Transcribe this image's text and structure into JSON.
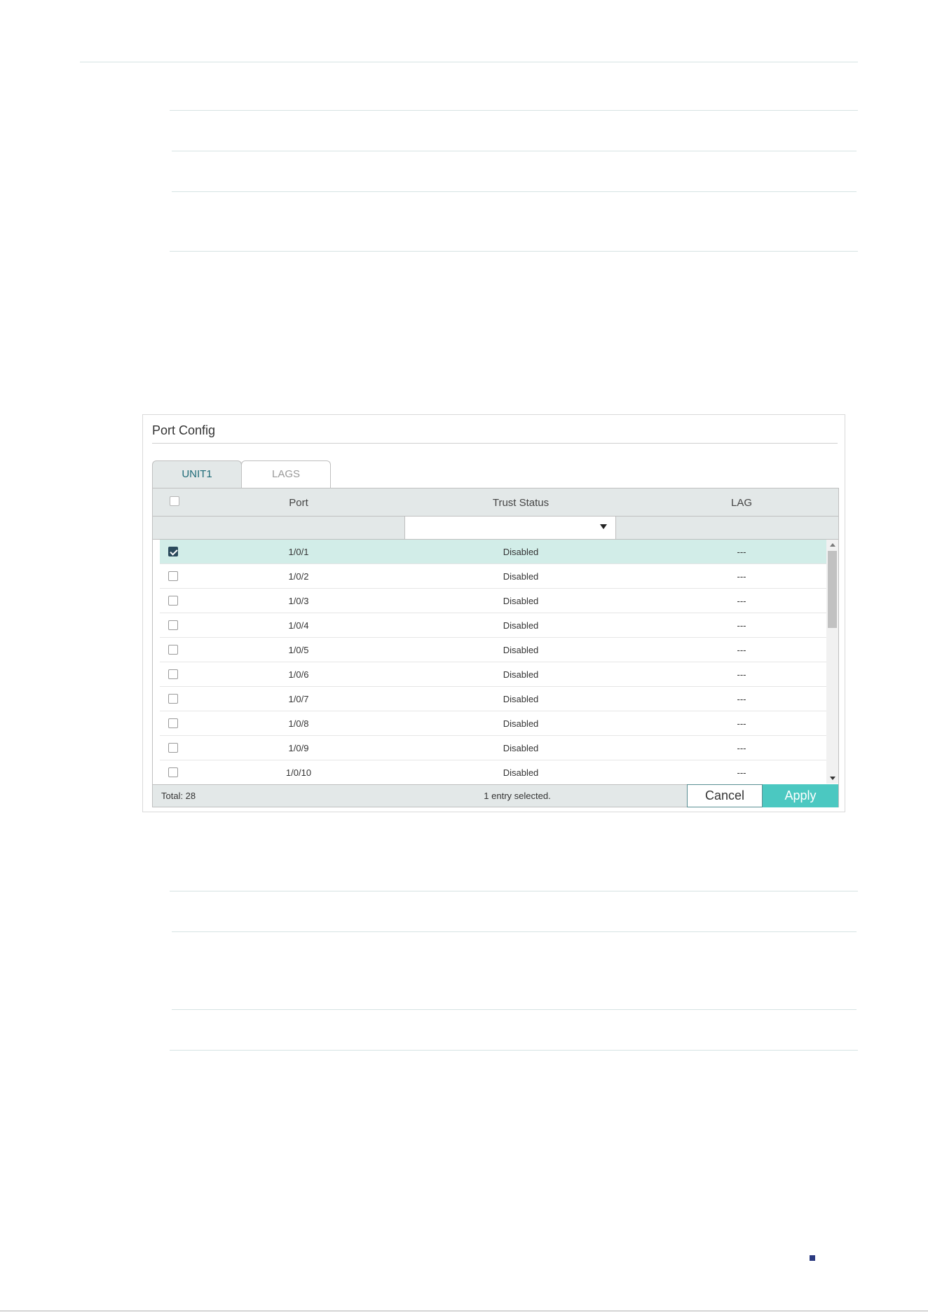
{
  "panel": {
    "title": "Port Config",
    "tabs": [
      {
        "label": "UNIT1",
        "active": true
      },
      {
        "label": "LAGS",
        "active": false
      }
    ],
    "columns": {
      "port": "Port",
      "trust_status": "Trust Status",
      "lag": "LAG"
    },
    "rows": [
      {
        "port": "1/0/1",
        "trust_status": "Disabled",
        "lag": "---",
        "checked": true
      },
      {
        "port": "1/0/2",
        "trust_status": "Disabled",
        "lag": "---",
        "checked": false
      },
      {
        "port": "1/0/3",
        "trust_status": "Disabled",
        "lag": "---",
        "checked": false
      },
      {
        "port": "1/0/4",
        "trust_status": "Disabled",
        "lag": "---",
        "checked": false
      },
      {
        "port": "1/0/5",
        "trust_status": "Disabled",
        "lag": "---",
        "checked": false
      },
      {
        "port": "1/0/6",
        "trust_status": "Disabled",
        "lag": "---",
        "checked": false
      },
      {
        "port": "1/0/7",
        "trust_status": "Disabled",
        "lag": "---",
        "checked": false
      },
      {
        "port": "1/0/8",
        "trust_status": "Disabled",
        "lag": "---",
        "checked": false
      },
      {
        "port": "1/0/9",
        "trust_status": "Disabled",
        "lag": "---",
        "checked": false
      },
      {
        "port": "1/0/10",
        "trust_status": "Disabled",
        "lag": "---",
        "checked": false
      }
    ],
    "footer": {
      "total": "Total: 28",
      "selected": "1 entry selected.",
      "cancel_label": "Cancel",
      "apply_label": "Apply"
    }
  },
  "icons": {
    "dropdown": "caret-down-icon",
    "scroll_up": "scroll-up-arrow-icon",
    "scroll_down": "scroll-down-arrow-icon",
    "checkbox_checked": "checkmark-icon"
  },
  "colors": {
    "header_bg": "#e3e8e8",
    "selected_row_bg": "#d2ede8",
    "apply_button": "#4bc8c1",
    "checked_box": "#2b4a5c",
    "active_tab_text": "#1f6b78",
    "page_mark": "#2b3a80"
  }
}
